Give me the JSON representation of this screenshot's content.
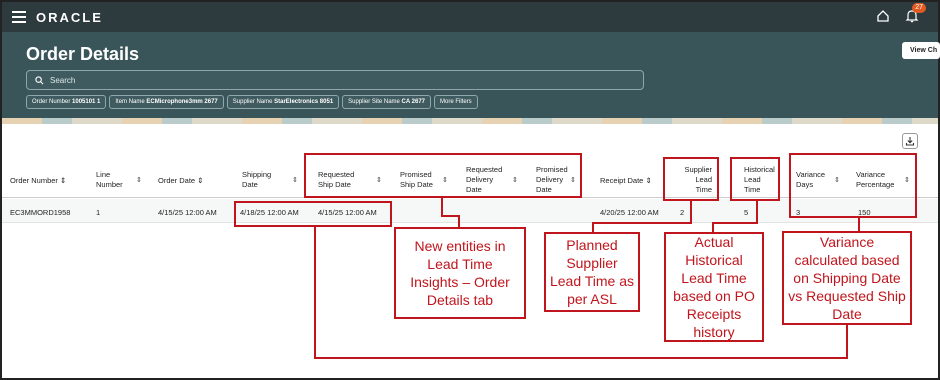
{
  "topbar": {
    "logo": "ORACLE",
    "notification_count": "27"
  },
  "header": {
    "title": "Order Details",
    "view_button": "View Ch",
    "search_placeholder": "Search",
    "filters": [
      {
        "label": "Order Number",
        "value": "1005101 1"
      },
      {
        "label": "Item Name",
        "value": "ECMicrophone3mm 2677"
      },
      {
        "label": "Supplier Name",
        "value": "StarElectronics 8051"
      },
      {
        "label": "Supplier Site Name",
        "value": "CA 2677"
      },
      {
        "label": "More Filters",
        "value": ""
      }
    ]
  },
  "table": {
    "columns": {
      "order_number": "Order Number",
      "line_number": [
        "Line",
        "Number"
      ],
      "order_date": "Order Date",
      "shipping_date": [
        "Shipping",
        "Date"
      ],
      "requested_ship_date": [
        "Requested",
        "Ship Date"
      ],
      "promised_ship_date": [
        "Promised",
        "Ship Date"
      ],
      "requested_delivery_date": [
        "Requested",
        "Delivery",
        "Date"
      ],
      "promised_delivery_date": [
        "Promised",
        "Delivery",
        "Date"
      ],
      "receipt_date": "Receipt Date",
      "supplier_lead_time": [
        "Supplier",
        "Lead",
        "Time"
      ],
      "historical_lead_time": [
        "Historical",
        "Lead",
        "Time"
      ],
      "variance_days": [
        "Variance",
        "Days"
      ],
      "variance_percentage": [
        "Variance",
        "Percentage"
      ]
    },
    "row": {
      "order_number": "EC3MMORD1958",
      "line_number": "1",
      "order_date": "4/15/25 12:00 AM",
      "shipping_date": "4/18/25 12:00 AM",
      "requested_ship_date": "4/15/25 12:00 AM",
      "receipt_date": "4/20/25 12:00 AM",
      "supplier_lead_time": "2",
      "historical_lead_time": "5",
      "variance_days": "3",
      "variance_percentage": "150"
    }
  },
  "annotations": {
    "new_entities": [
      "New entities in",
      "Lead Time",
      "Insights – Order",
      "Details tab"
    ],
    "planned_supplier": [
      "Planned",
      "Supplier",
      "Lead Time as",
      "per ASL"
    ],
    "actual_historical": [
      "Actual",
      "Historical",
      "Lead Time",
      "based on PO",
      "Receipts",
      "history"
    ],
    "variance": [
      "Variance",
      "calculated based",
      "on Shipping Date",
      "vs Requested Ship",
      "Date"
    ]
  },
  "colors": {
    "header_bg": "#3a5559",
    "topbar_bg": "#2d3a3e",
    "annotation_red": "#c0151c"
  }
}
